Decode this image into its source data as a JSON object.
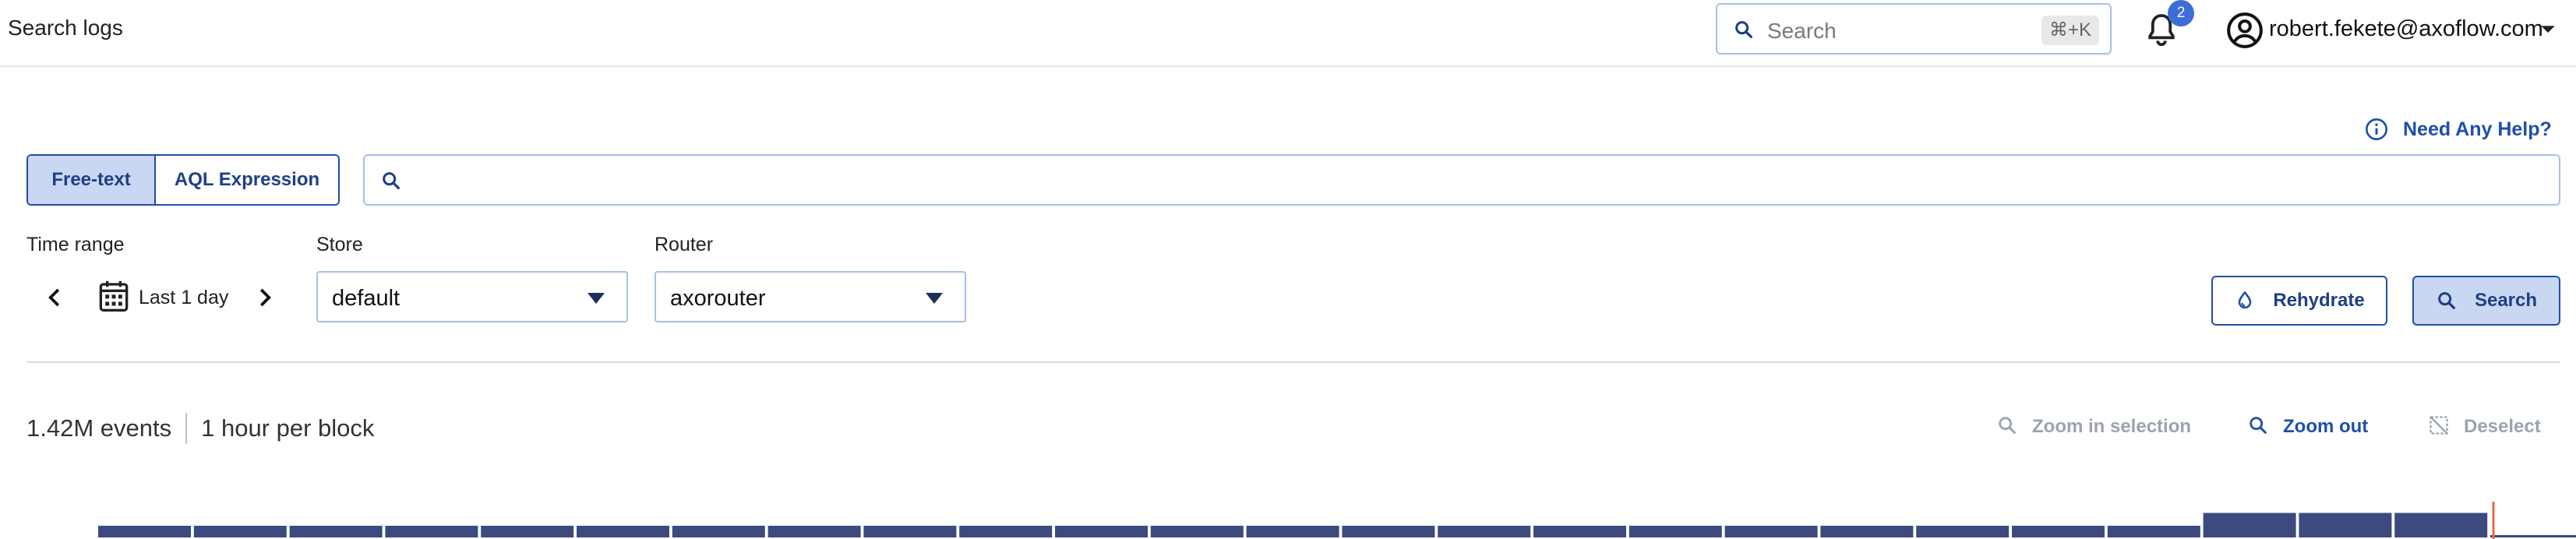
{
  "header": {
    "title": "Search logs",
    "search_placeholder": "Search",
    "search_shortcut": "⌘+K",
    "notification_count": "2",
    "user_email": "robert.fekete@axoflow.com"
  },
  "help": {
    "label": "Need Any Help?"
  },
  "query_mode": {
    "options": [
      "Free-text",
      "AQL Expression"
    ],
    "selected": "Free-text",
    "input_value": ""
  },
  "filters": {
    "time_range_label": "Time range",
    "time_range_value": "Last 1 day",
    "store_label": "Store",
    "store_value": "default",
    "router_label": "Router",
    "router_value": "axorouter"
  },
  "actions": {
    "rehydrate": "Rehydrate",
    "search": "Search"
  },
  "histogram": {
    "events": "1.42M events",
    "block": "1 hour per block",
    "zoom_in": "Zoom in selection",
    "zoom_out": "Zoom out",
    "deselect": "Deselect"
  },
  "chart_data": {
    "type": "bar",
    "values": [
      1,
      1,
      1,
      1,
      1,
      1,
      1,
      1,
      1,
      1,
      1,
      1,
      1,
      1,
      1,
      1,
      1,
      1,
      1,
      1,
      1,
      1,
      2.1,
      2.1,
      2.1,
      0.2
    ],
    "color": "#3d4a7f",
    "marker_color": "#e36a45"
  },
  "colors": {
    "accent": "#1f4fa8",
    "accent_bg": "#c9d7f2",
    "border": "#a9bfe6"
  }
}
